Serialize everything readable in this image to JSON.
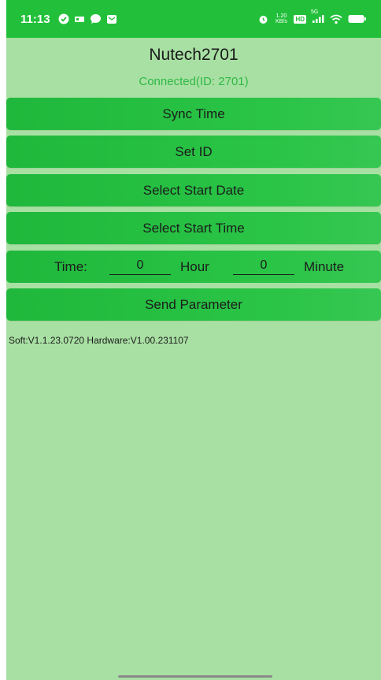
{
  "status_bar": {
    "time": "11:13",
    "net_speed": "1.20 KB/s",
    "hd_badge": "HD",
    "network_type": "5G",
    "left_icons": [
      "check-circle-icon",
      "sim-icon",
      "chat-bubble-icon",
      "message-icon"
    ],
    "right_icons": [
      "alarm-icon",
      "signal-icon",
      "wifi-icon",
      "battery-icon"
    ]
  },
  "device": {
    "name": "Nutech2701",
    "connection_status": "Connected(ID: 2701)"
  },
  "buttons": {
    "sync_time": "Sync Time",
    "set_id": "Set ID",
    "select_start_date": "Select Start Date",
    "select_start_time": "Select Start Time",
    "send_parameter": "Send Parameter"
  },
  "time_row": {
    "time_label": "Time:",
    "hour_value": "0",
    "hour_label": "Hour",
    "minute_value": "0",
    "minute_label": "Minute"
  },
  "version_info": "Soft:V1.1.23.0720 Hardware:V1.00.231107",
  "colors": {
    "background": "#a8e0a3",
    "button": "#22c03a",
    "connected_text": "#2fb845"
  }
}
